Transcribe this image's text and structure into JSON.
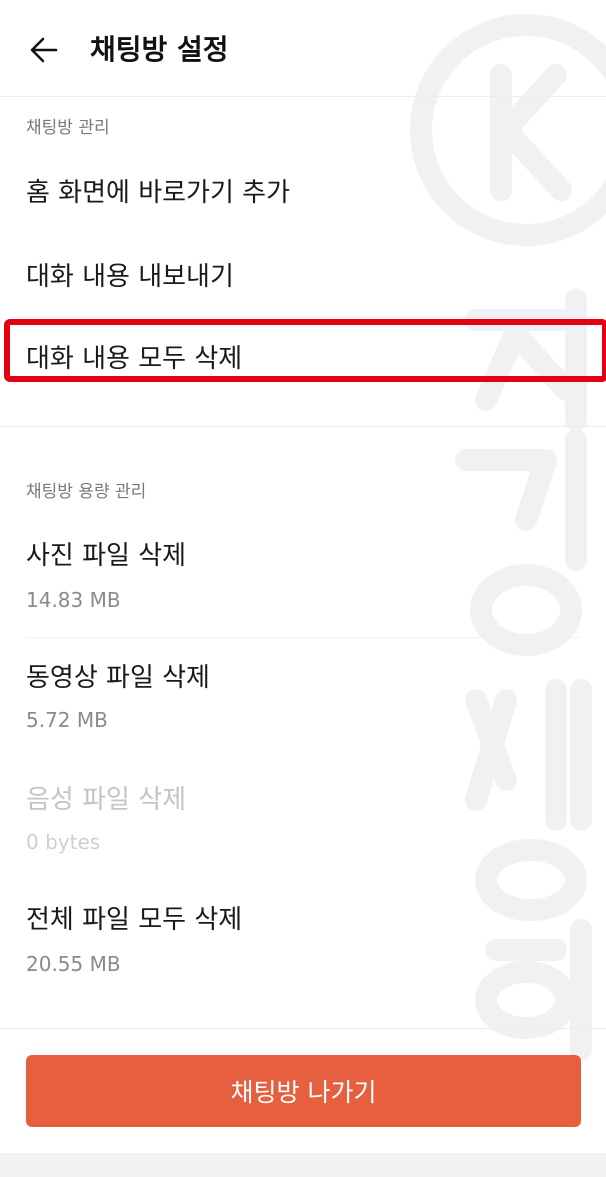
{
  "header": {
    "title": "채팅방 설정",
    "back_icon": "arrow-left-icon"
  },
  "sections": {
    "management": {
      "label": "채팅방 관리",
      "items": [
        {
          "label": "홈 화면에 바로가기 추가"
        },
        {
          "label": "대화 내용 내보내기"
        },
        {
          "label": "대화 내용 모두 삭제"
        }
      ]
    },
    "storage": {
      "label": "채팅방 용량 관리",
      "items": [
        {
          "label": "사진 파일 삭제",
          "size": "14.83 MB"
        },
        {
          "label": "동영상 파일 삭제",
          "size": "5.72 MB"
        },
        {
          "label": "음성 파일 삭제",
          "size": "0 bytes"
        },
        {
          "label": "전체 파일 모두 삭제",
          "size": "20.55 MB"
        }
      ]
    }
  },
  "leave_button": {
    "label": "채팅방 나가기"
  },
  "colors": {
    "accent": "#e65f3f",
    "highlight": "#e50012"
  }
}
